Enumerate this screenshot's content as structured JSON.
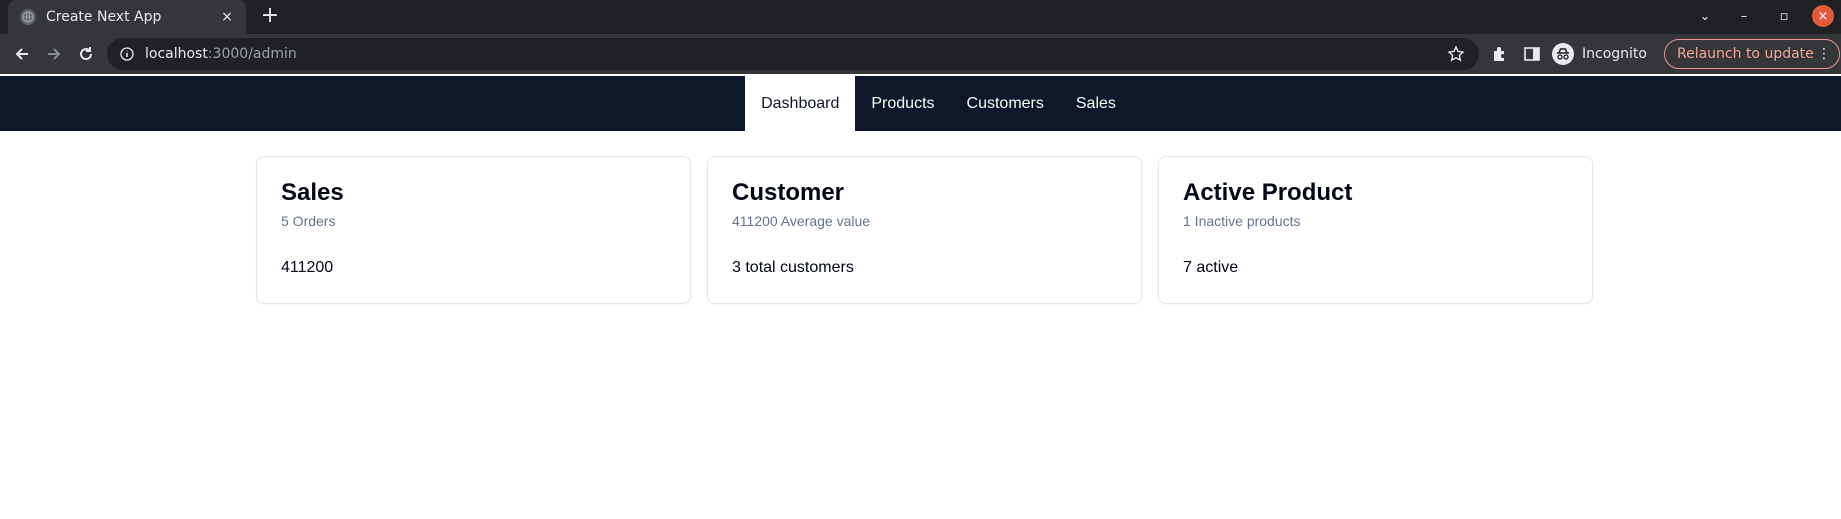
{
  "browser": {
    "tab_title": "Create Next App",
    "tab_close": "×",
    "new_tab": "+",
    "url_host": "localhost",
    "url_rest": ":3000/admin",
    "profile_label": "Incognito",
    "relaunch_label": "Relaunch to update",
    "menu_dots": "⋮",
    "window_controls": {
      "tab_search": "⌄",
      "minimize": "–",
      "restore": "▫",
      "close": "×"
    }
  },
  "nav": {
    "items": [
      {
        "label": "Dashboard",
        "active": true
      },
      {
        "label": "Products",
        "active": false
      },
      {
        "label": "Customers",
        "active": false
      },
      {
        "label": "Sales",
        "active": false
      }
    ]
  },
  "cards": [
    {
      "title": "Sales",
      "description": "5 Orders",
      "value": "411200"
    },
    {
      "title": "Customer",
      "description": "411200 Average value",
      "value": "3 total customers"
    },
    {
      "title": "Active Product",
      "description": "1 Inactive products",
      "value": "7 active"
    }
  ],
  "colors": {
    "navbar_bg": "#0f172a",
    "card_border": "#e2e8f0",
    "muted_text": "#64748b"
  }
}
